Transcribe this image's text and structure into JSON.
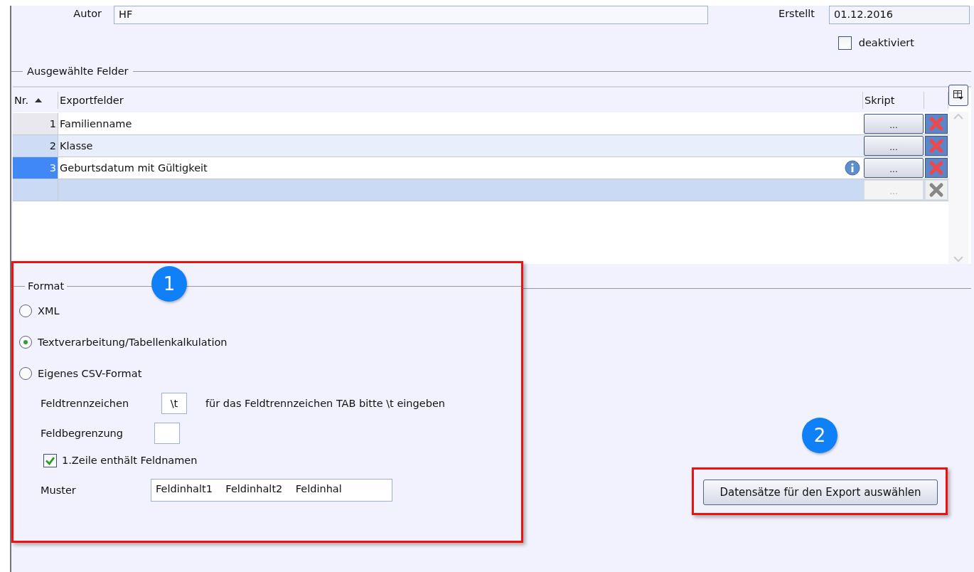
{
  "header": {
    "author": {
      "label": "Autor",
      "value": "HF"
    },
    "created": {
      "label": "Erstellt",
      "value": "01.12.2016"
    },
    "deactivated": {
      "label": "deaktiviert",
      "checked": false
    }
  },
  "selected_fields": {
    "title": "Ausgewählte Felder",
    "columns": [
      "Nr.",
      "Exportfelder",
      "Skript"
    ],
    "rows": [
      {
        "nr": "1",
        "field": "Familienname",
        "script": "...",
        "info": false,
        "selected": false
      },
      {
        "nr": "2",
        "field": "Klasse",
        "script": "...",
        "info": false,
        "selected": false
      },
      {
        "nr": "3",
        "field": "Geburtsdatum mit Gültigkeit",
        "script": "...",
        "info": true,
        "selected": true
      }
    ],
    "new_row": {
      "script": "..."
    }
  },
  "format": {
    "title": "Format",
    "options": [
      {
        "label": "XML",
        "selected": false
      },
      {
        "label": "Textverarbeitung/Tabellenkalkulation",
        "selected": true
      },
      {
        "label": "Eigenes CSV-Format",
        "selected": false
      }
    ],
    "separator": {
      "label": "Feldtrennzeichen",
      "value": "\\t",
      "hint": "für das Feldtrennzeichen TAB bitte \\t eingeben"
    },
    "delimiter": {
      "label": "Feldbegrenzung"
    },
    "header_row": {
      "label": "1.Zeile enthält Feldnamen",
      "checked": true
    },
    "pattern": {
      "label": "Muster",
      "value": "Feldinhalt1    Feldinhalt2    Feldinhal"
    }
  },
  "export_button": "Datensätze für den Export auswählen",
  "annotations": [
    {
      "label": "1"
    },
    {
      "label": "2"
    }
  ]
}
